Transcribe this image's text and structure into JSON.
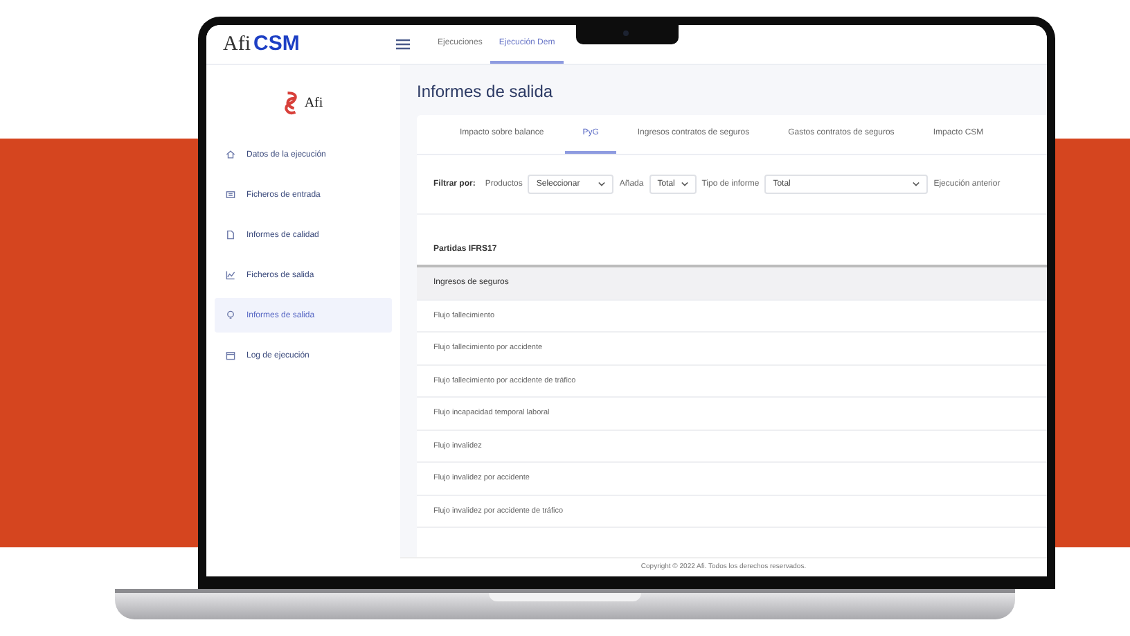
{
  "header": {
    "logo_prefix": "Afi",
    "logo_name": "CSM",
    "tabs": [
      {
        "label": "Ejecuciones",
        "selected": false
      },
      {
        "label": "Ejecución Dem",
        "selected": true
      }
    ]
  },
  "sidebar": {
    "brand": "Afi",
    "items": [
      {
        "label": "Datos de la ejecución",
        "selected": false
      },
      {
        "label": "Ficheros de entrada",
        "selected": false
      },
      {
        "label": "Informes de calidad",
        "selected": false
      },
      {
        "label": "Ficheros de salida",
        "selected": false
      },
      {
        "label": "Informes de salida",
        "selected": true
      },
      {
        "label": "Log de ejecución",
        "selected": false
      }
    ]
  },
  "page_title": "Informes de salida",
  "report_tabs": [
    {
      "label": "Impacto sobre balance",
      "selected": false
    },
    {
      "label": "PyG",
      "selected": true
    },
    {
      "label": "Ingresos contratos de seguros",
      "selected": false
    },
    {
      "label": "Gastos contratos de seguros",
      "selected": false
    },
    {
      "label": "Impacto CSM",
      "selected": false
    }
  ],
  "filters": {
    "label": "Filtrar por:",
    "fields": [
      {
        "label": "Productos",
        "value": "Seleccionar"
      },
      {
        "label": "Añada",
        "value": "Total"
      },
      {
        "label": "Tipo de informe",
        "value": "Total"
      }
    ],
    "trailing_label": "Ejecución anterior"
  },
  "table": {
    "column": "Partidas IFRS17",
    "rows": [
      {
        "label": "Ingresos de seguros",
        "kind": "group"
      },
      {
        "label": "Flujo fallecimiento",
        "kind": "item"
      },
      {
        "label": "Flujo fallecimiento por accidente",
        "kind": "item"
      },
      {
        "label": "Flujo fallecimiento por accidente de tráfico",
        "kind": "item"
      },
      {
        "label": "Flujo incapacidad temporal laboral",
        "kind": "item"
      },
      {
        "label": "Flujo invalidez",
        "kind": "item"
      },
      {
        "label": "Flujo invalidez por accidente",
        "kind": "item"
      },
      {
        "label": "Flujo invalidez por accidente de tráfico",
        "kind": "item"
      }
    ]
  },
  "footer": "Copyright © 2022 Afi. Todos los derechos reservados."
}
